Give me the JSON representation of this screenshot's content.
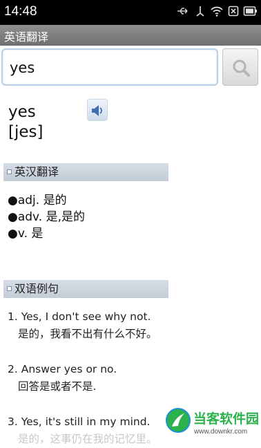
{
  "status": {
    "time": "14:48"
  },
  "app": {
    "title": "英语翻译"
  },
  "search": {
    "value": "yes",
    "button_icon": "search-icon"
  },
  "entry": {
    "word": "yes",
    "phonetic": "[jes]"
  },
  "sections": {
    "translation": "英汉翻译",
    "examples": "双语例句"
  },
  "definitions": [
    "●adj. 是的",
    "●adv. 是,是的",
    "●v. 是"
  ],
  "examples": [
    {
      "en": "1. Yes, I don't see why not.",
      "zh": "是的，我看不出有什么不好。"
    },
    {
      "en": "2. Answer yes or no.",
      "zh": "回答是或者不是."
    },
    {
      "en": "3. Yes, it's still in my mind.",
      "zh": "是的，这事仍在我的记忆里。"
    }
  ],
  "watermark": {
    "name": "当客软件园",
    "url": "www.downkr.com"
  },
  "colors": {
    "statusbar": "#000000",
    "appbar": "#7f7f7f",
    "section": "#cbd3dd",
    "search_border": "#b8cfe6",
    "logo_green": "#2bb24c"
  }
}
